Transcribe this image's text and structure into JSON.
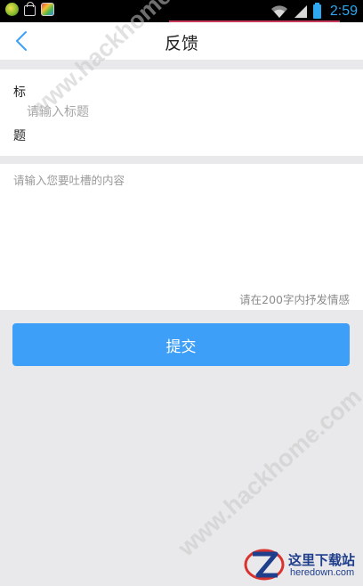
{
  "status_bar": {
    "time": "2:59",
    "icons": [
      "app-icon",
      "shopping-bag-icon",
      "colorful-app-icon",
      "wifi-icon",
      "signal-icon",
      "battery-icon"
    ]
  },
  "nav": {
    "title": "反馈",
    "back_icon": "chevron-left-icon"
  },
  "form": {
    "title_label_line1": "标",
    "title_label_line2": "题",
    "title_placeholder": "请输入标题",
    "title_value": "",
    "content_placeholder": "请输入您要吐槽的内容",
    "content_value": "",
    "char_limit_hint": "请在200字内抒发情感"
  },
  "submit": {
    "label": "提交"
  },
  "watermarks": {
    "diagonal_text_1": "www.hackhome.com",
    "diagonal_text_2": "www.hackhome.com",
    "logo_main": "这里下载站",
    "logo_sub": "heredown.com"
  },
  "colors": {
    "accent": "#3d9ff8",
    "status_time": "#2ea8f0",
    "page_background": "#e9e9eb",
    "logo": "#1f3e8c"
  }
}
